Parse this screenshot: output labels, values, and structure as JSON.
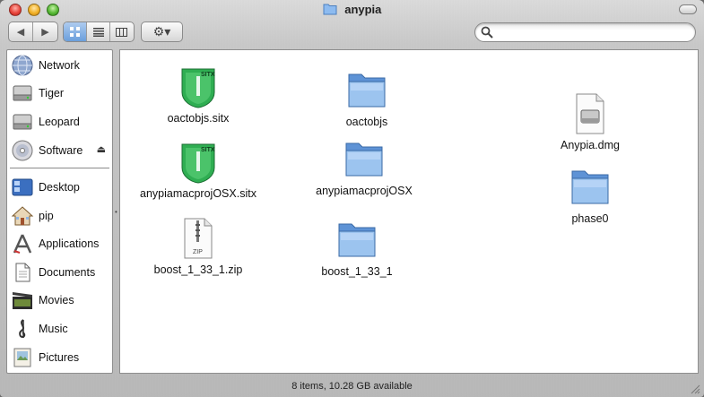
{
  "window": {
    "title": "anypia"
  },
  "toolbar": {
    "back_glyph": "◀",
    "forward_glyph": "▶",
    "view_buttons": [
      "icon-view",
      "list-view",
      "column-view"
    ],
    "action_glyph": "⚙▾",
    "search": {
      "placeholder": "",
      "value": ""
    }
  },
  "sidebar": {
    "devices": [
      {
        "label": "Network",
        "icon": "network-globe-icon"
      },
      {
        "label": "Tiger",
        "icon": "hard-drive-icon"
      },
      {
        "label": "Leopard",
        "icon": "hard-drive-icon"
      },
      {
        "label": "Software",
        "icon": "disc-icon",
        "eject": "⏏"
      }
    ],
    "places": [
      {
        "label": "Desktop",
        "icon": "desktop-icon"
      },
      {
        "label": "pip",
        "icon": "home-icon"
      },
      {
        "label": "Applications",
        "icon": "applications-icon"
      },
      {
        "label": "Documents",
        "icon": "documents-icon"
      },
      {
        "label": "Movies",
        "icon": "movies-icon"
      },
      {
        "label": "Music",
        "icon": "music-icon"
      },
      {
        "label": "Pictures",
        "icon": "pictures-icon"
      }
    ]
  },
  "files": [
    {
      "name": "oactobjs.sitx",
      "kind": "sitx-archive-icon",
      "badge": "SITX"
    },
    {
      "name": "anypiamacprojOSX.sitx",
      "kind": "sitx-archive-icon",
      "badge": "SITX"
    },
    {
      "name": "boost_1_33_1.zip",
      "kind": "zip-archive-icon",
      "badge": "ZIP"
    },
    {
      "name": "oactobjs",
      "kind": "folder-icon"
    },
    {
      "name": "anypiamacprojOSX",
      "kind": "folder-icon"
    },
    {
      "name": "boost_1_33_1",
      "kind": "folder-icon"
    },
    {
      "name": "Anypia.dmg",
      "kind": "disk-image-icon"
    },
    {
      "name": "phase0",
      "kind": "folder-icon"
    }
  ],
  "status": {
    "text": "8 items, 10.28 GB available"
  },
  "colors": {
    "selection_blue": "#6a9fdc",
    "folder_blue": "#7fb0e8",
    "sitx_green": "#2fae52"
  }
}
